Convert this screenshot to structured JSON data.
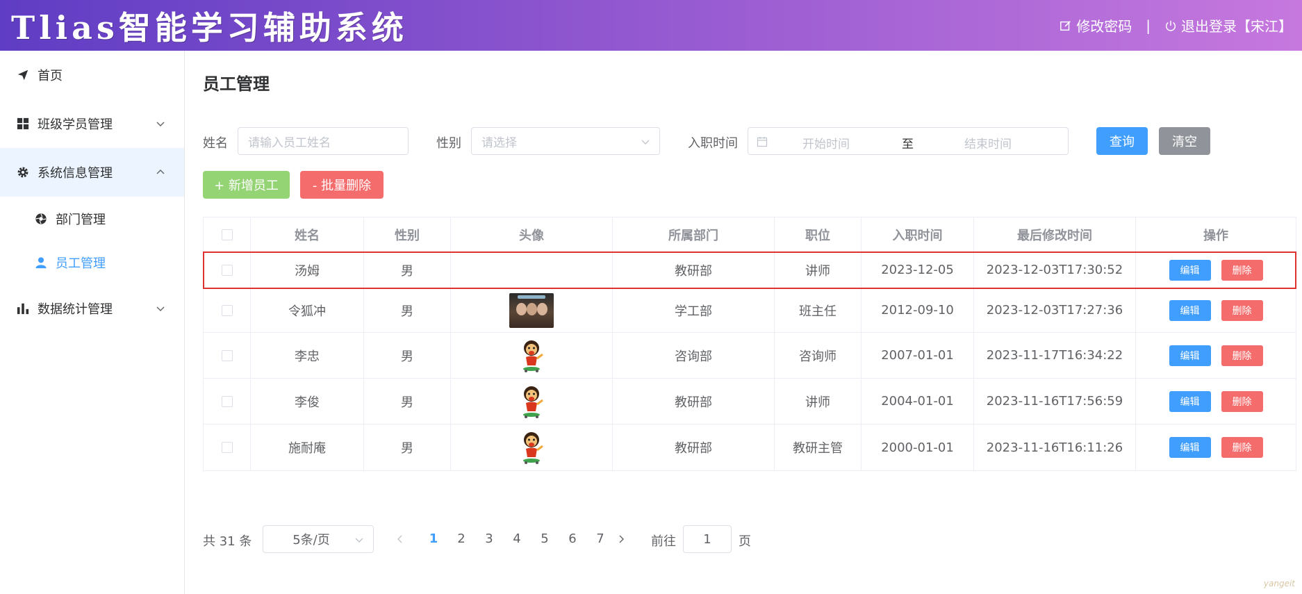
{
  "header": {
    "app_title": "Tlias智能学习辅助系统",
    "change_password": "修改密码",
    "separator": "|",
    "logout": "退出登录【宋江】",
    "gradient": [
      "#5f3dc4",
      "#c678de"
    ]
  },
  "sidebar": {
    "items": [
      {
        "label": "首页",
        "icon": "paper-plane-icon"
      },
      {
        "label": "班级学员管理",
        "icon": "grid-icon",
        "expanded": false
      },
      {
        "label": "系统信息管理",
        "icon": "gear-icon",
        "expanded": true,
        "children": [
          {
            "label": "部门管理",
            "icon": "aperture-icon",
            "active": false
          },
          {
            "label": "员工管理",
            "icon": "user-icon",
            "active": true
          }
        ]
      },
      {
        "label": "数据统计管理",
        "icon": "bar-chart-icon",
        "expanded": false
      }
    ]
  },
  "main": {
    "title": "员工管理",
    "search": {
      "name_label": "姓名",
      "name_placeholder": "请输入员工姓名",
      "gender_label": "性别",
      "gender_placeholder": "请选择",
      "date_label": "入职时间",
      "date_start": "开始时间",
      "date_sep": "至",
      "date_end": "结束时间",
      "query_button": "查询",
      "clear_button": "清空"
    },
    "actions": {
      "add_button": "+ 新增员工",
      "batch_delete_button": "- 批量删除"
    },
    "table": {
      "columns": [
        "姓名",
        "性别",
        "头像",
        "所属部门",
        "职位",
        "入职时间",
        "最后修改时间",
        "操作"
      ],
      "edit_label": "编辑",
      "delete_label": "删除",
      "rows": [
        {
          "name": "汤姆",
          "gender": "男",
          "avatar": "none",
          "dept": "教研部",
          "job": "讲师",
          "entry": "2023-12-05",
          "updated": "2023-12-03T17:30:52"
        },
        {
          "name": "令狐冲",
          "gender": "男",
          "avatar": "photo",
          "dept": "学工部",
          "job": "班主任",
          "entry": "2012-09-10",
          "updated": "2023-12-03T17:27:36"
        },
        {
          "name": "李忠",
          "gender": "男",
          "avatar": "cartoon",
          "dept": "咨询部",
          "job": "咨询师",
          "entry": "2007-01-01",
          "updated": "2023-11-17T16:34:22"
        },
        {
          "name": "李俊",
          "gender": "男",
          "avatar": "cartoon",
          "dept": "教研部",
          "job": "讲师",
          "entry": "2004-01-01",
          "updated": "2023-11-16T17:56:59"
        },
        {
          "name": "施耐庵",
          "gender": "男",
          "avatar": "cartoon",
          "dept": "教研部",
          "job": "教研主管",
          "entry": "2000-01-01",
          "updated": "2023-11-16T16:11:26"
        }
      ]
    },
    "pagination": {
      "total": "共 31 条",
      "page_size": "5条/页",
      "pages": [
        "1",
        "2",
        "3",
        "4",
        "5",
        "6",
        "7"
      ],
      "current": "1",
      "goto_label": "前往",
      "goto_value": "1",
      "page_unit": "页"
    }
  },
  "watermark": "yangeit",
  "colors": {
    "primary": "#409eff",
    "danger": "#f56c6c",
    "success": "#95d475",
    "info": "#909399",
    "selected_row_outline": "#e03131"
  }
}
